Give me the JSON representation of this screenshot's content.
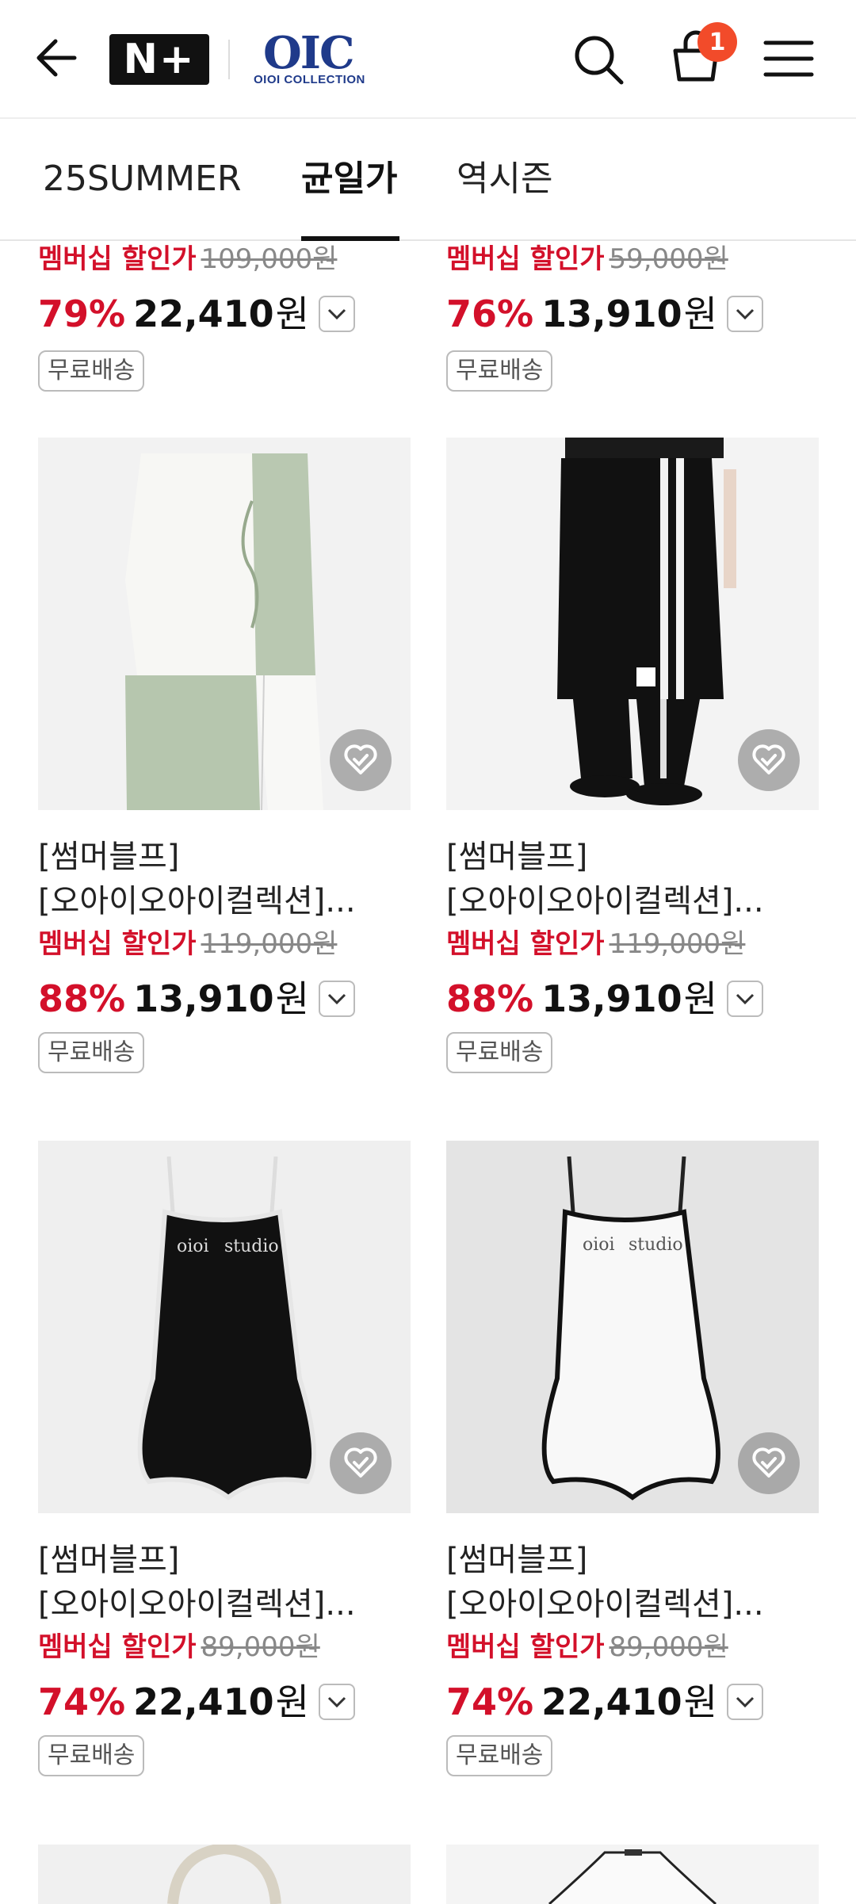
{
  "header": {
    "back_icon": "arrow-left-icon",
    "nplus_logo": "N+",
    "brand_logo_mark": "OIC",
    "brand_logo_sub": "OIOI COLLECTION",
    "search_icon": "search-icon",
    "cart_icon": "shopping-bag-icon",
    "cart_count": "1",
    "menu_icon": "hamburger-menu-icon"
  },
  "tabs": [
    {
      "label": "25SUMMER",
      "active": false
    },
    {
      "label": "균일가",
      "active": true
    },
    {
      "label": "역시즌",
      "active": false
    }
  ],
  "products": [
    {
      "title_1": "",
      "title_2": "",
      "member_label": "멤버십 할인가",
      "original_price": "109,000원",
      "discount": "79%",
      "sale_price": "22,410",
      "currency": "원",
      "shipping": "무료배송"
    },
    {
      "title_1": "",
      "title_2": "",
      "member_label": "멤버십 할인가",
      "original_price": "59,000원",
      "discount": "76%",
      "sale_price": "13,910",
      "currency": "원",
      "shipping": "무료배송"
    },
    {
      "title_1": "[썸머블프]",
      "title_2": "[오아이오아이컬렉션]...",
      "member_label": "멤버십 할인가",
      "original_price": "119,000원",
      "discount": "88%",
      "sale_price": "13,910",
      "currency": "원",
      "shipping": "무료배송"
    },
    {
      "title_1": "[썸머블프]",
      "title_2": "[오아이오아이컬렉션]...",
      "member_label": "멤버십 할인가",
      "original_price": "119,000원",
      "discount": "88%",
      "sale_price": "13,910",
      "currency": "원",
      "shipping": "무료배송"
    },
    {
      "title_1": "[썸머블프]",
      "title_2": "[오아이오아이컬렉션]...",
      "member_label": "멤버십 할인가",
      "original_price": "89,000원",
      "discount": "74%",
      "sale_price": "22,410",
      "currency": "원",
      "shipping": "무료배송",
      "print_left": "oioi",
      "print_right": "studio"
    },
    {
      "title_1": "[썸머블프]",
      "title_2": "[오아이오아이컬렉션]...",
      "member_label": "멤버십 할인가",
      "original_price": "89,000원",
      "discount": "74%",
      "sale_price": "22,410",
      "currency": "원",
      "shipping": "무료배송",
      "print_left": "oioi",
      "print_right": "studio"
    }
  ],
  "colors": {
    "discount_red": "#d3102a",
    "badge_orange": "#f24b2a",
    "brand_blue": "#1f3a8a"
  }
}
